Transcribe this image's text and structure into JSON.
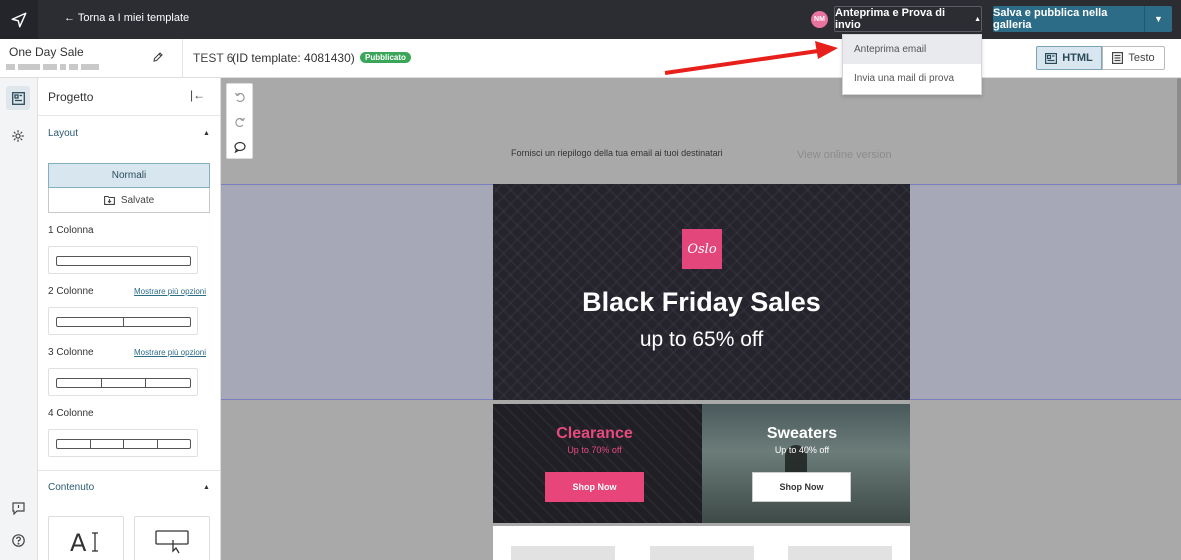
{
  "topbar": {
    "back_label": "← Torna a I miei template",
    "avatar_initials": "NM",
    "preview_label": "Anteprima e Prova di invio",
    "publish_label": "Salva e pubblica nella galleria"
  },
  "dropdown": {
    "items": [
      "Anteprima email",
      "Invia una mail di prova"
    ]
  },
  "subheader": {
    "project_name": "One Day Sale",
    "template_title": "TEST 6",
    "template_id": "(ID template: 4081430)",
    "status_badge": "Pubblicato",
    "html_label": "HTML",
    "text_label": "Testo"
  },
  "panel": {
    "title": "Progetto",
    "layout_title": "Layout",
    "tab_normali": "Normali",
    "tab_salvate": "Salvate",
    "columns": [
      {
        "label": "1 Colonna",
        "more": ""
      },
      {
        "label": "2 Colonne",
        "more": "Mostrare più opzioni"
      },
      {
        "label": "3 Colonne",
        "more": "Mostrare più opzioni"
      },
      {
        "label": "4 Colonne",
        "more": ""
      }
    ],
    "content_title": "Contenuto"
  },
  "email": {
    "preheader": "Fornisci un riepilogo della tua email ai tuoi destinatari",
    "view_online": "View online version",
    "logo_text": "Oslo",
    "hero_title": "Black Friday Sales",
    "hero_sub": "up to 65% off",
    "promo_left": {
      "title": "Clearance",
      "sub": "Up to 70% off",
      "button": "Shop Now"
    },
    "promo_right": {
      "title": "Sweaters",
      "sub": "Up to 40% off",
      "button": "Shop Now"
    }
  },
  "colors": {
    "topbar_bg": "#2b2d33",
    "accent": "#2d6c86",
    "badge": "#3aa659",
    "pink": "#e3467a",
    "arrow": "#e8201c"
  },
  "icons": [
    "send-icon",
    "pencil-icon",
    "html-icon",
    "text-icon",
    "layout-icon",
    "gear-icon",
    "feedback-icon",
    "help-icon",
    "undo-icon",
    "redo-icon",
    "comment-icon",
    "collapse-icon",
    "save-icon",
    "text-block-icon",
    "button-block-icon"
  ]
}
